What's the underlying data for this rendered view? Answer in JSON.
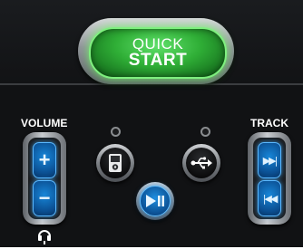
{
  "quick_start": {
    "line1": "QUICK",
    "line2": "START"
  },
  "volume": {
    "label": "VOLUME",
    "up": "+",
    "down": "−"
  },
  "track": {
    "label": "TRACK",
    "next": "▶▶|",
    "prev": "|◀◀"
  },
  "buttons": {
    "ipod_icon": "ipod-icon",
    "usb_icon": "usb-icon",
    "play_pause_icon": "play-pause-icon",
    "headphones_icon": "headphones-icon"
  },
  "colors": {
    "panel": "#111214",
    "quick_start_green": "#2fae36",
    "button_blue": "#0b4f92",
    "chrome": "#c9ccd0"
  }
}
